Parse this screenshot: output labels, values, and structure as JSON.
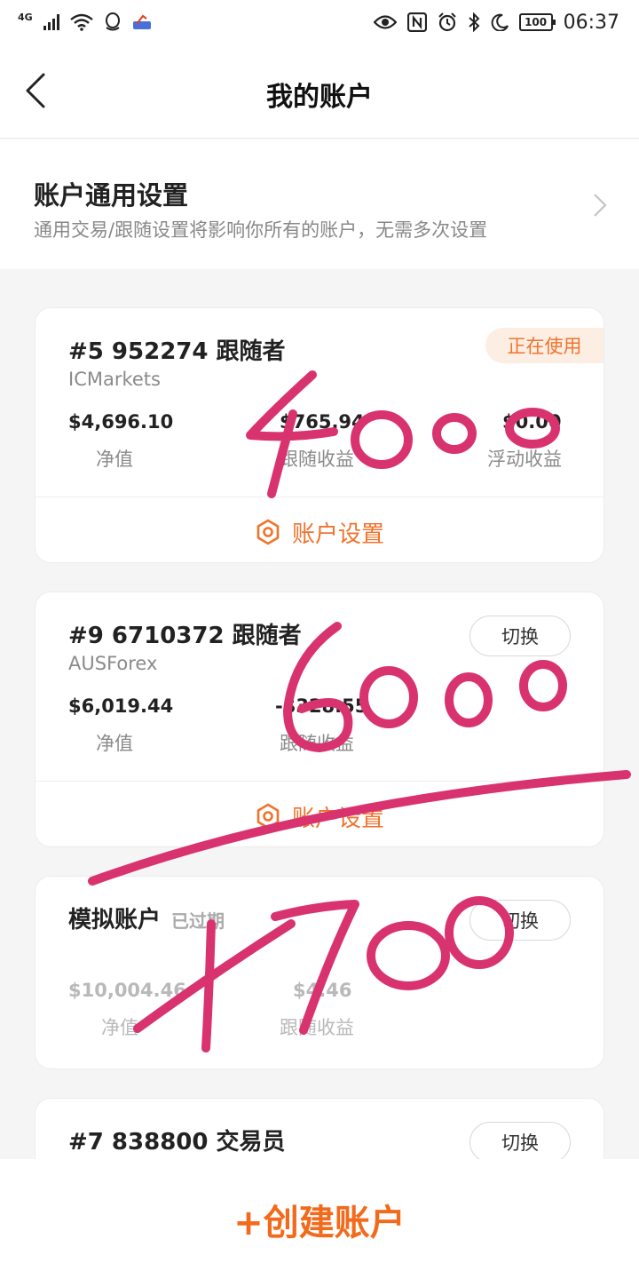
{
  "status_bar": {
    "network": "4G",
    "battery": "100",
    "time": "06:37"
  },
  "nav": {
    "title": "我的账户"
  },
  "general_settings": {
    "title": "账户通用设置",
    "subtitle": "通用交易/跟随设置将影响你所有的账户，无需多次设置"
  },
  "accounts": [
    {
      "title": "#5 952274 跟随者",
      "broker": "ICMarkets",
      "badge": "正在使用",
      "stats": [
        {
          "value": "$4,696.10",
          "label": "净值"
        },
        {
          "value": "$765.94",
          "label": "跟随收益"
        },
        {
          "value": "$0.00",
          "label": "浮动收益"
        }
      ],
      "settings_label": "账户设置"
    },
    {
      "title": "#9 6710372 跟随者",
      "broker": "AUSForex",
      "switch_label": "切换",
      "stats": [
        {
          "value": "$6,019.44",
          "label": "净值"
        },
        {
          "value": "-$328.55",
          "label": "跟随收益"
        }
      ],
      "settings_label": "账户设置"
    },
    {
      "title": "模拟账户",
      "status": "已过期",
      "switch_label": "切换",
      "stats": [
        {
          "value": "$10,004.46",
          "label": "净值"
        },
        {
          "value": "$4.46",
          "label": "跟随收益"
        }
      ]
    },
    {
      "title": "#7 838800 交易员",
      "switch_label": "切换"
    }
  ],
  "create": {
    "label": "+创建账户"
  },
  "handwriting": [
    "4000",
    "6000",
    "1700"
  ],
  "colors": {
    "accent": "#f0732d",
    "ink": "#d8336f"
  }
}
